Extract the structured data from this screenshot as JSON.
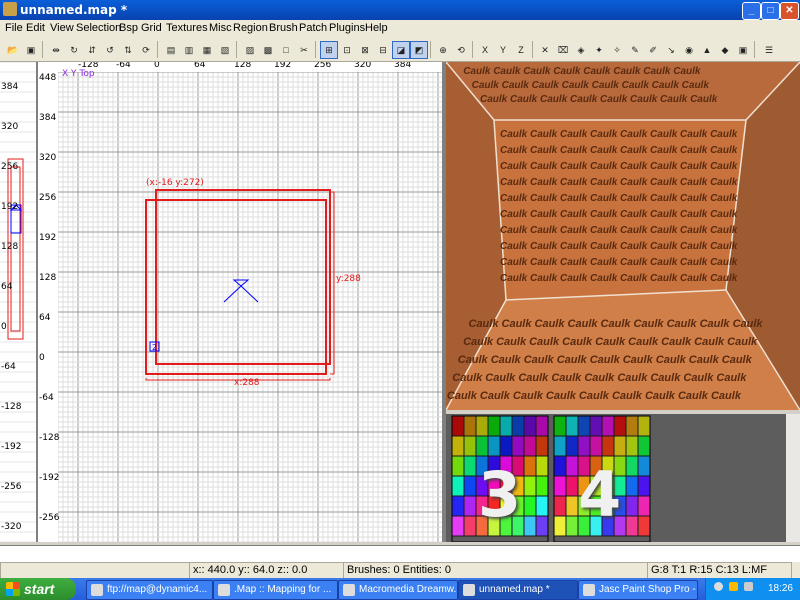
{
  "window": {
    "title": "unnamed.map *",
    "min": "_",
    "max": "□",
    "close": "✕"
  },
  "menu": [
    "File",
    "Edit",
    "View",
    "Selection",
    "Bsp",
    "Grid",
    "Textures",
    "Misc",
    "Region",
    "Brush",
    "Patch",
    "Plugins",
    "Help"
  ],
  "xy_view": {
    "label": "X Y Top",
    "x_ticks": [
      "-128",
      "-64",
      "0",
      "64",
      "128",
      "192",
      "256",
      "320",
      "384"
    ],
    "y_ticks": [
      "448",
      "384",
      "320",
      "256",
      "192",
      "128",
      "64",
      "0",
      "-64",
      "-128",
      "-192",
      "-256"
    ],
    "selection_label": "(x:-16  y:272)",
    "width_label": "x:288",
    "height_label": "y:288",
    "entity_marker": "2"
  },
  "z_view": {
    "ticks": [
      "384",
      "320",
      "256",
      "192",
      "128",
      "64",
      "0",
      "-64",
      "-128",
      "-192",
      "-256",
      "-320"
    ]
  },
  "camera": {
    "texture_word": "Caulk"
  },
  "texture_browser": {
    "tile_3": "3",
    "tile_4": "4"
  },
  "status": {
    "coords": "x::  440.0  y::  64.0  z::  0.0",
    "counts": "Brushes: 0  Entities: 0",
    "grid": "G:8  T:1  R:15  C:13  L:MF"
  },
  "taskbar": {
    "start": "start",
    "tasks": [
      {
        "label": "ftp://map@dynamic4..."
      },
      {
        "label": ".Map :: Mapping for ..."
      },
      {
        "label": "Macromedia Dreamw..."
      },
      {
        "label": "unnamed.map *"
      },
      {
        "label": "Jasc Paint Shop Pro - ..."
      },
      {
        "label": "..."
      }
    ],
    "clock": "18:26"
  },
  "colors": {
    "titlebar": "#0a5fd8",
    "brush_outline": "#e31b1b",
    "grid": "#c8c8c8",
    "camera_wall": "#c8733e",
    "taskbar": "#245edb"
  }
}
